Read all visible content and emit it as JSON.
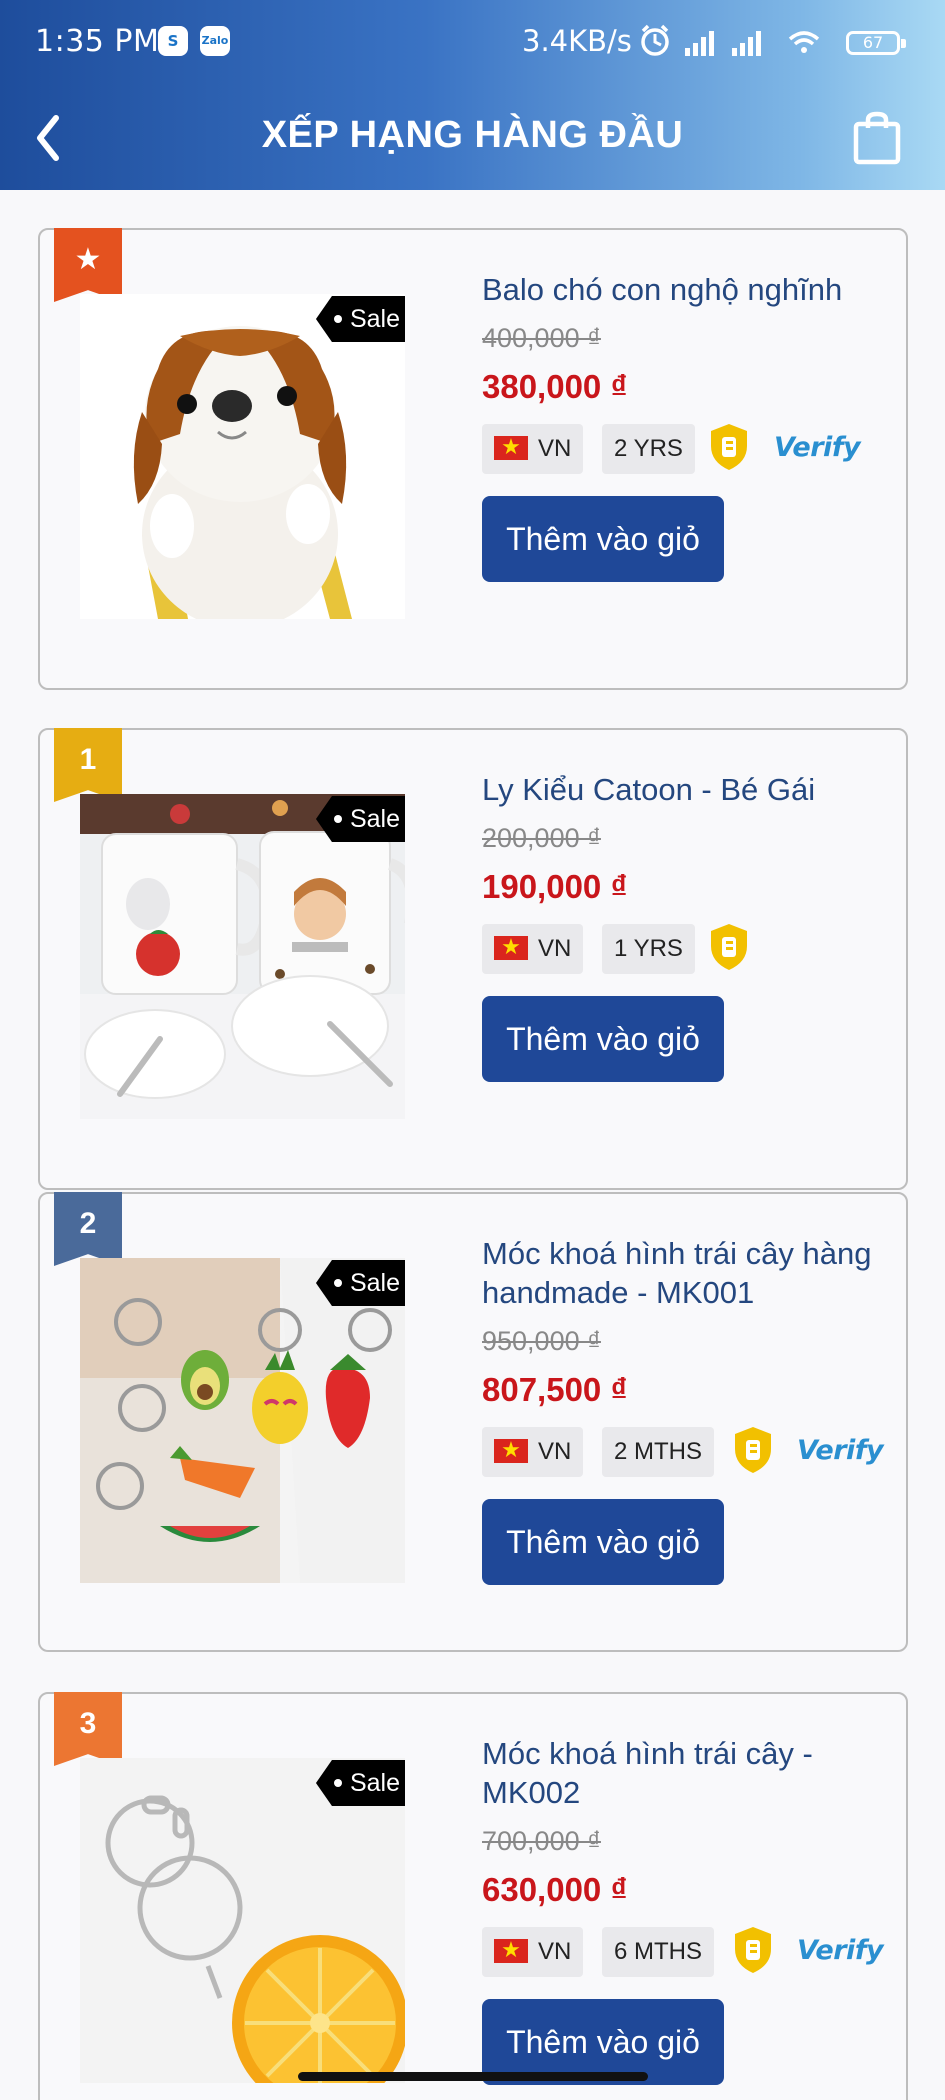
{
  "status": {
    "time": "1:35 PM",
    "app1": "S",
    "app2": "Zalo",
    "network": "3.4KB/s",
    "battery": "67"
  },
  "header": {
    "title": "XẾP HẠNG HÀNG ĐẦU"
  },
  "products": [
    {
      "rank": "★",
      "sale": "Sale",
      "name": "Balo chó con nghộ nghĩnh",
      "old_price": "400,000 ₫",
      "price": "380,000 ₫",
      "country": "VN",
      "age": "2 YRS",
      "verify": "Verify",
      "cart": "Thêm vào giỏ"
    },
    {
      "rank": "1",
      "sale": "Sale",
      "name": "Ly Kiểu Catoon - Bé Gái",
      "old_price": "200,000 ₫",
      "price": "190,000 ₫",
      "country": "VN",
      "age": "1 YRS",
      "verify": "",
      "cart": "Thêm vào giỏ"
    },
    {
      "rank": "2",
      "sale": "Sale",
      "name": "Móc khoá hình trái cây hàng handmade - MK001",
      "old_price": "950,000 ₫",
      "price": "807,500 ₫",
      "country": "VN",
      "age": "2 MTHS",
      "verify": "Verify",
      "cart": "Thêm vào giỏ"
    },
    {
      "rank": "3",
      "sale": "Sale",
      "name": "Móc khoá hình trái cây - MK002",
      "old_price": "700,000 ₫",
      "price": "630,000 ₫",
      "country": "VN",
      "age": "6 MTHS",
      "verify": "Verify",
      "cart": "Thêm vào giỏ"
    }
  ]
}
